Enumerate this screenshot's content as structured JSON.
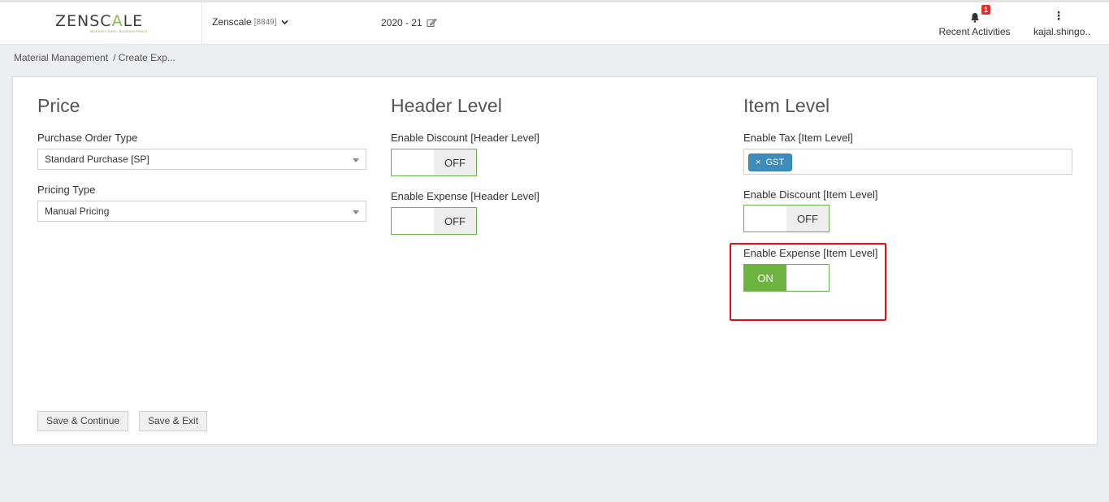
{
  "header": {
    "logo": {
      "text_main": "ZENSC",
      "text_accent": "A",
      "text_end": "LE",
      "tagline": "Business Ease. Business Peace."
    },
    "company": {
      "name": "Zenscale",
      "code": "[8849]"
    },
    "year": "2020 - 21",
    "recent_activities": {
      "label": "Recent Activities",
      "badge": "1"
    },
    "user": {
      "label": "kajal.shingo.."
    }
  },
  "breadcrumb": {
    "root": "Material Management",
    "current": "/ Create Exp..."
  },
  "price": {
    "title": "Price",
    "purchase_order_type": {
      "label": "Purchase Order Type",
      "value": "Standard Purchase [SP]"
    },
    "pricing_type": {
      "label": "Pricing Type",
      "value": "Manual Pricing"
    }
  },
  "header_level": {
    "title": "Header Level",
    "enable_discount": {
      "label": "Enable Discount [Header Level]",
      "state": "OFF"
    },
    "enable_expense": {
      "label": "Enable Expense [Header Level]",
      "state": "OFF"
    }
  },
  "item_level": {
    "title": "Item Level",
    "enable_tax": {
      "label": "Enable Tax [Item Level]",
      "tags": [
        "GST"
      ],
      "remove_glyph": "×"
    },
    "enable_discount": {
      "label": "Enable Discount [Item Level]",
      "state": "OFF"
    },
    "enable_expense": {
      "label": "Enable Expense [Item Level]",
      "state": "ON"
    }
  },
  "buttons": {
    "save_continue": "Save & Continue",
    "save_exit": "Save & Exit"
  },
  "colors": {
    "accent_green": "#6cb33f",
    "tag_blue": "#3c8dbc",
    "highlight_red": "#e01010",
    "badge_red": "#d9332b"
  },
  "icons": {
    "company_dropdown": "chevron-down-icon",
    "year_edit": "edit-icon",
    "notifications": "bell-icon",
    "user_menu": "vertical-dots-icon"
  }
}
